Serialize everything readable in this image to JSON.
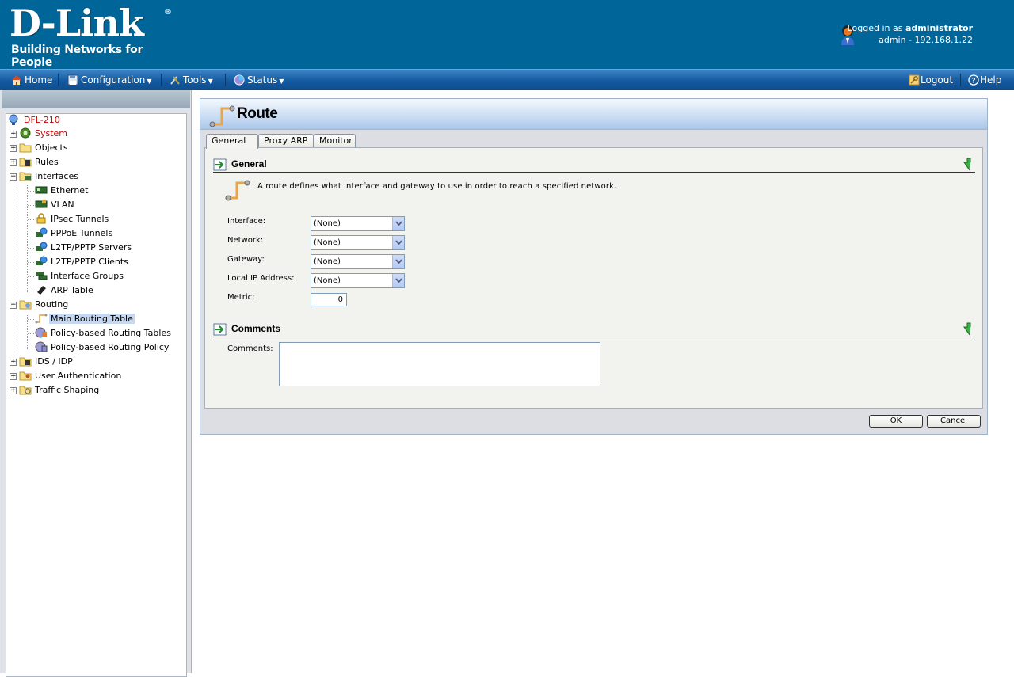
{
  "header": {
    "brand": "D-Link",
    "registered": "®",
    "tagline": "Building Networks for People",
    "logged_in_prefix": "Logged in as",
    "username": "administrator",
    "session": "admin - 192.168.1.22"
  },
  "menu": {
    "home": "Home",
    "configuration": "Configuration",
    "tools": "Tools",
    "status": "Status",
    "logout": "Logout",
    "help": "Help"
  },
  "tree": {
    "root": "DFL-210",
    "system": "System",
    "objects": "Objects",
    "rules": "Rules",
    "interfaces": "Interfaces",
    "ethernet": "Ethernet",
    "vlan": "VLAN",
    "ipsec": "IPsec Tunnels",
    "pppoe": "PPPoE Tunnels",
    "l2tp_servers": "L2TP/PPTP Servers",
    "l2tp_clients": "L2TP/PPTP Clients",
    "interface_groups": "Interface Groups",
    "arp_table": "ARP Table",
    "routing": "Routing",
    "main_routing_table": "Main Routing Table",
    "pbr_tables": "Policy-based Routing Tables",
    "pbr_policy": "Policy-based Routing Policy",
    "ids_idp": "IDS / IDP",
    "user_auth": "User Authentication",
    "traffic_shaping": "Traffic Shaping"
  },
  "panel": {
    "title": "Route",
    "tabs": [
      "General",
      "Proxy ARP",
      "Monitor"
    ],
    "general_heading": "General",
    "description": "A route defines what interface and gateway to use in order to reach a specified network.",
    "fields": {
      "interface_label": "Interface:",
      "interface_value": "(None)",
      "network_label": "Network:",
      "network_value": "(None)",
      "gateway_label": "Gateway:",
      "gateway_value": "(None)",
      "local_ip_label": "Local IP Address:",
      "local_ip_value": "(None)",
      "metric_label": "Metric:",
      "metric_value": "0"
    },
    "comments_heading": "Comments",
    "comments_label": "Comments:",
    "ok": "OK",
    "cancel": "Cancel"
  }
}
